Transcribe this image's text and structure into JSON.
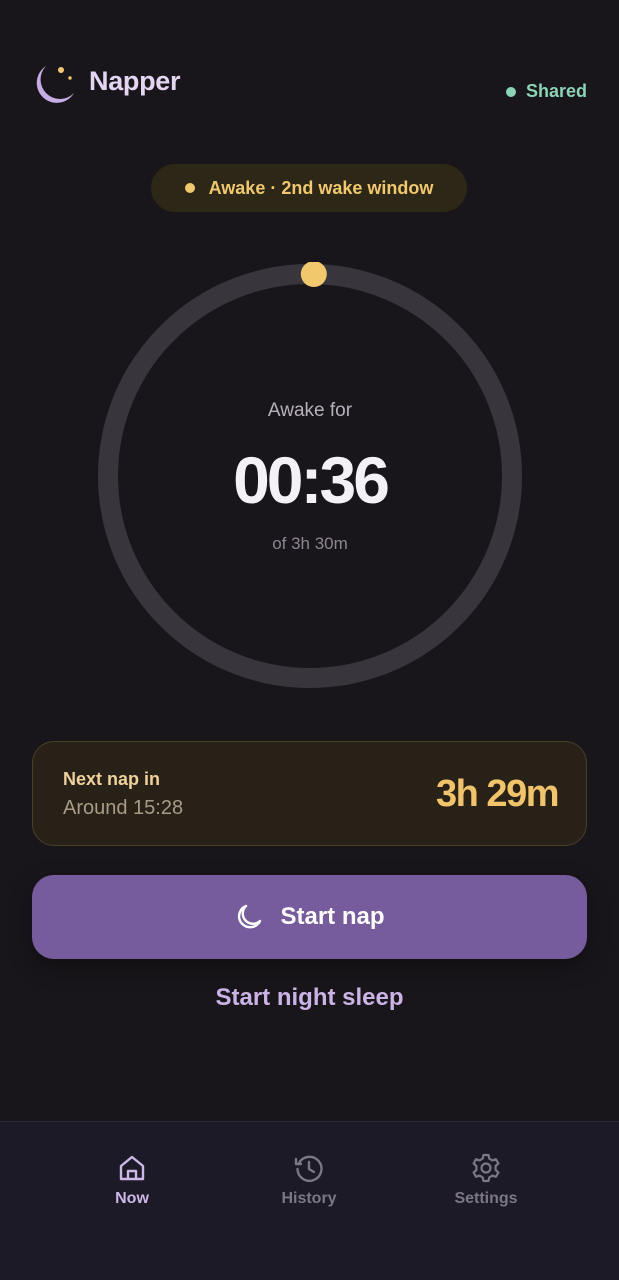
{
  "header": {
    "app_title": "Napper",
    "logo_icon": "moon-stars-icon",
    "shared_label": "Shared",
    "shared_color": "#8ad3b4"
  },
  "state_pill": {
    "label": "Awake · 2nd wake window",
    "color": "#f1c86b"
  },
  "timer": {
    "label": "Awake for",
    "elapsed": "00:36",
    "total": "of 3h 30m",
    "progress_fraction": 0.003,
    "ring_color": "#39353d",
    "marker_color": "#f1c86b"
  },
  "next_nap": {
    "title": "Next nap in",
    "subtitle": "Around 15:28",
    "value": "3h 29m"
  },
  "actions": {
    "start_nap_label": "Start nap",
    "start_nap_icon": "moon-icon",
    "night_sleep_label": "Start night sleep",
    "accent_color": "#775c9d"
  },
  "nav": {
    "items": [
      {
        "label": "Now",
        "icon": "home-icon",
        "active": true
      },
      {
        "label": "History",
        "icon": "history-icon",
        "active": false
      },
      {
        "label": "Settings",
        "icon": "gear-icon",
        "active": false
      }
    ]
  }
}
